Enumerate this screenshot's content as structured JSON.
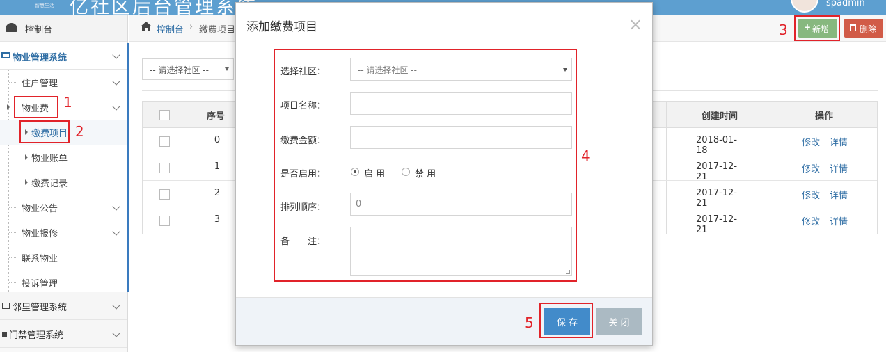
{
  "header": {
    "brand_sub": "智慧生活",
    "title": "亿社区后台管理系统",
    "username": "spadmin"
  },
  "sidebar": {
    "dashboard": "控制台",
    "property_system": "物业管理系统",
    "items": [
      {
        "label": "住户管理"
      },
      {
        "label": "物业费"
      },
      {
        "label": "缴费项目"
      },
      {
        "label": "物业账单"
      },
      {
        "label": "缴费记录"
      },
      {
        "label": "物业公告"
      },
      {
        "label": "物业报修"
      },
      {
        "label": "联系物业"
      },
      {
        "label": "投诉管理"
      }
    ],
    "neighbor_system": "邻里管理系统",
    "door_system": "门禁管理系统"
  },
  "breadcrumb": {
    "home": "控制台",
    "current": "缴费项目"
  },
  "toolbar": {
    "add_label": "新增",
    "delete_label": "删除"
  },
  "filter": {
    "community_placeholder": "-- 请选择社区 --"
  },
  "table": {
    "headers": {
      "seq": "序号",
      "created": "创建时间",
      "action": "操作"
    },
    "rows": [
      {
        "seq": "0",
        "created": "2018-01-18",
        "edit": "修改",
        "detail": "详情"
      },
      {
        "seq": "1",
        "created": "2017-12-21",
        "edit": "修改",
        "detail": "详情"
      },
      {
        "seq": "2",
        "created": "2017-12-21",
        "edit": "修改",
        "detail": "详情"
      },
      {
        "seq": "3",
        "created": "2017-12-21",
        "edit": "修改",
        "detail": "详情"
      }
    ]
  },
  "modal": {
    "title": "添加缴费项目",
    "close_glyph": "×",
    "fields": {
      "community_label": "选择社区：",
      "community_value": "-- 请选择社区 --",
      "name_label": "项目名称：",
      "name_value": "",
      "amount_label": "缴费金额：",
      "amount_value": "",
      "enabled_label": "是否启用：",
      "enabled_on": "启 用",
      "enabled_off": "禁 用",
      "enabled_selected": "启 用",
      "order_label": "排列顺序：",
      "order_value": "0",
      "remark_label": "备　　注：",
      "remark_value": ""
    },
    "save_label": "保 存",
    "close_label": "关 闭"
  },
  "annotations": [
    "1",
    "2",
    "3",
    "4",
    "5"
  ],
  "colors": {
    "header_bg": "#5d9fd0",
    "primary": "#428bca",
    "success": "#87b87f",
    "danger": "#d15b47",
    "annotation": "#e1232a"
  }
}
